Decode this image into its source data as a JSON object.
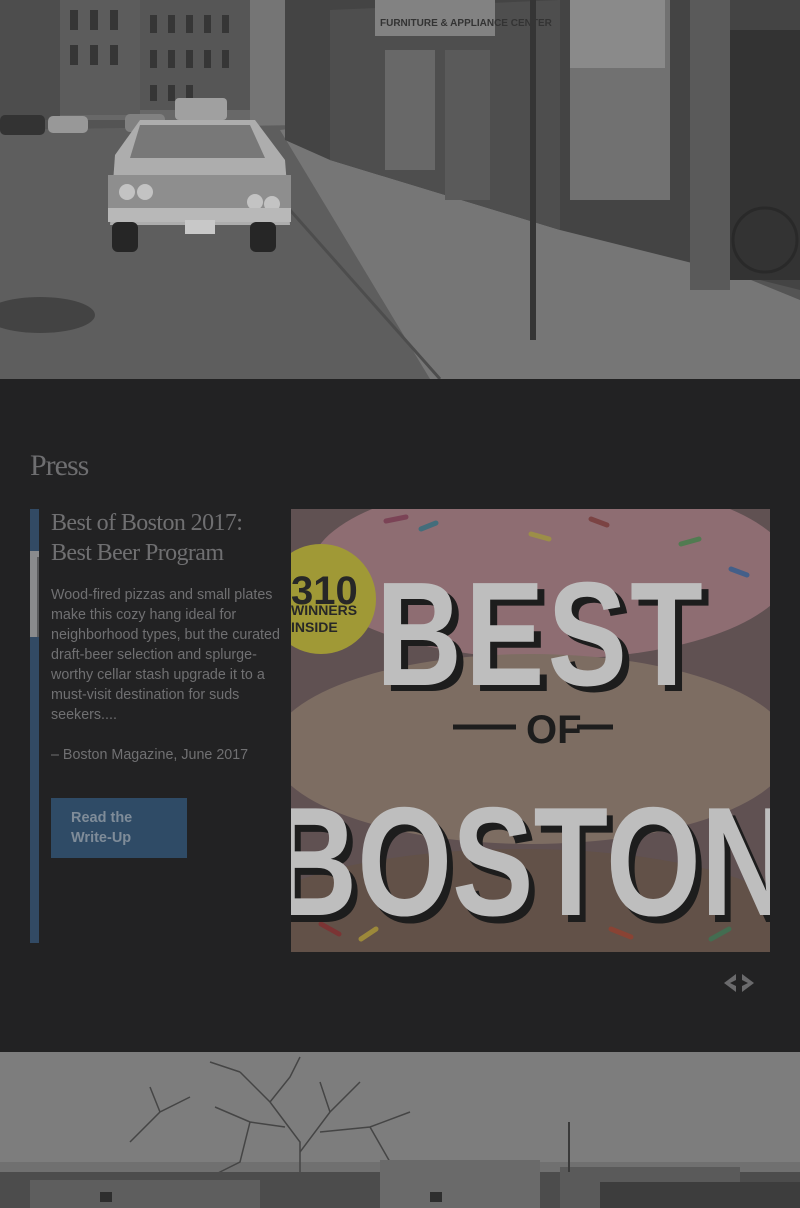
{
  "hero_top": {
    "image": "black-and-white street scene with parked car and storefronts",
    "sign_text": "FURNITURE & APPLIANCE CENTER"
  },
  "press": {
    "heading": "Press",
    "slides": [
      {
        "title_line1": "Best of Boston 2017:",
        "title_line2": "Best Beer Program",
        "body": "Wood-fired pizzas and small plates make this cozy hang ideal for neighborhood types, but the curated draft-beer selection and splurge-worthy cellar stash upgrade it to a must-visit destination for suds seekers....",
        "source": "– Boston Magazine, June 2017",
        "button_line1": "Read the",
        "button_line2": "Write-Up",
        "cover": {
          "badge_line1": "310",
          "badge_line2": "WINNERS",
          "badge_line3": "INSIDE",
          "title_top": "BEST",
          "title_mid": "OF",
          "title_bottom": "BOSTON"
        }
      }
    ],
    "prev_icon": "chevron-left-icon",
    "next_icon": "chevron-right-icon",
    "accent_color": "#324a64"
  },
  "hero_bottom": {
    "image": "black-and-white photo of buildings and a bare tree"
  }
}
